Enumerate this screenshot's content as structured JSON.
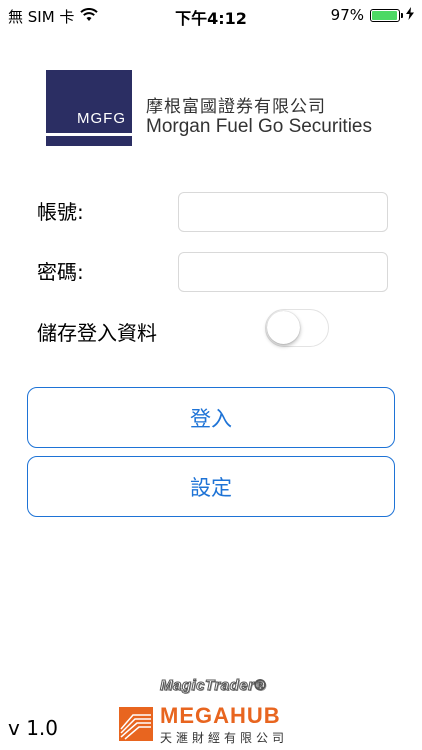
{
  "status_bar": {
    "carrier": "無 SIM 卡",
    "time": "下午4:12",
    "battery_percent": "97%",
    "battery_level": 0.97
  },
  "brand": {
    "logo_text": "MGFG",
    "name_cn": "摩根富國證券有限公司",
    "name_en": "Morgan Fuel Go Securities",
    "logo_color": "#2b2e63"
  },
  "form": {
    "account_label": "帳號:",
    "account_value": "",
    "password_label": "密碼:",
    "password_value": "",
    "save_login_label": "儲存登入資料",
    "save_login_enabled": false
  },
  "buttons": {
    "login": "登入",
    "settings": "設定",
    "accent_color": "#1e73d6"
  },
  "footer": {
    "version": "v 1.0",
    "magictrader": "MagicTrader®",
    "megahub": "MEGAHUB",
    "megahub_cn": "天滙財經有限公司",
    "megahub_color": "#e8651f"
  }
}
